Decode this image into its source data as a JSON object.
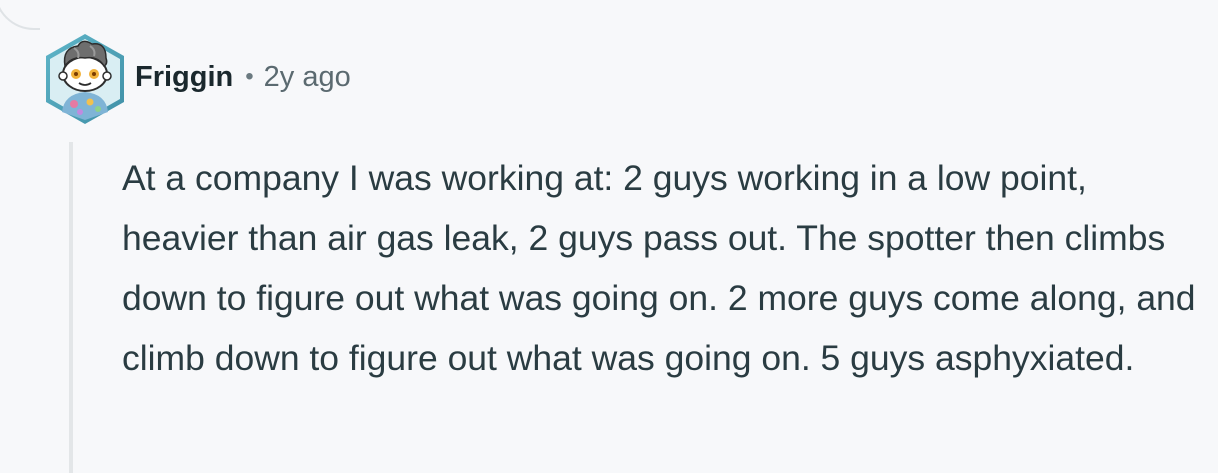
{
  "comment": {
    "author": "Friggin",
    "separator": "•",
    "timestamp": "2y ago",
    "avatar_icon": "snoo-avatar-icon",
    "body": "At a company I was working at: 2 guys working in a low point, heavier than air gas leak, 2 guys pass out. The spotter then climbs down to figure out what was going on. 2 more guys come along, and climb down to figure out what was going on. 5 guys asphyxiated."
  },
  "colors": {
    "background": "#f7f8fa",
    "text": "#2a3c42",
    "author": "#1a282d",
    "muted": "#5b6a70",
    "thread_line": "#e3e6e8"
  }
}
